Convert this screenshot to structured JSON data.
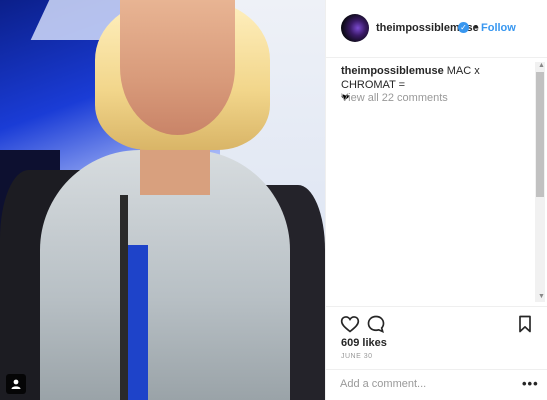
{
  "post": {
    "username": "theimpossiblemuse",
    "follow_label": "Follow",
    "separator": "•",
    "caption_text": "MAC x CHROMAT =",
    "caption_emoji": "❤",
    "view_all_comments": "View all 22 comments",
    "likes": "609 likes",
    "date": "JUNE 30",
    "comment_placeholder": "Add a comment...",
    "more_label": "•••"
  },
  "icons": {
    "verified": "verified-badge-icon",
    "like": "heart-icon",
    "comment": "comment-bubble-icon",
    "save": "bookmark-icon",
    "tag": "user-tag-icon"
  },
  "colors": {
    "accent": "#3897f0",
    "text": "#262626",
    "muted": "#999999"
  }
}
